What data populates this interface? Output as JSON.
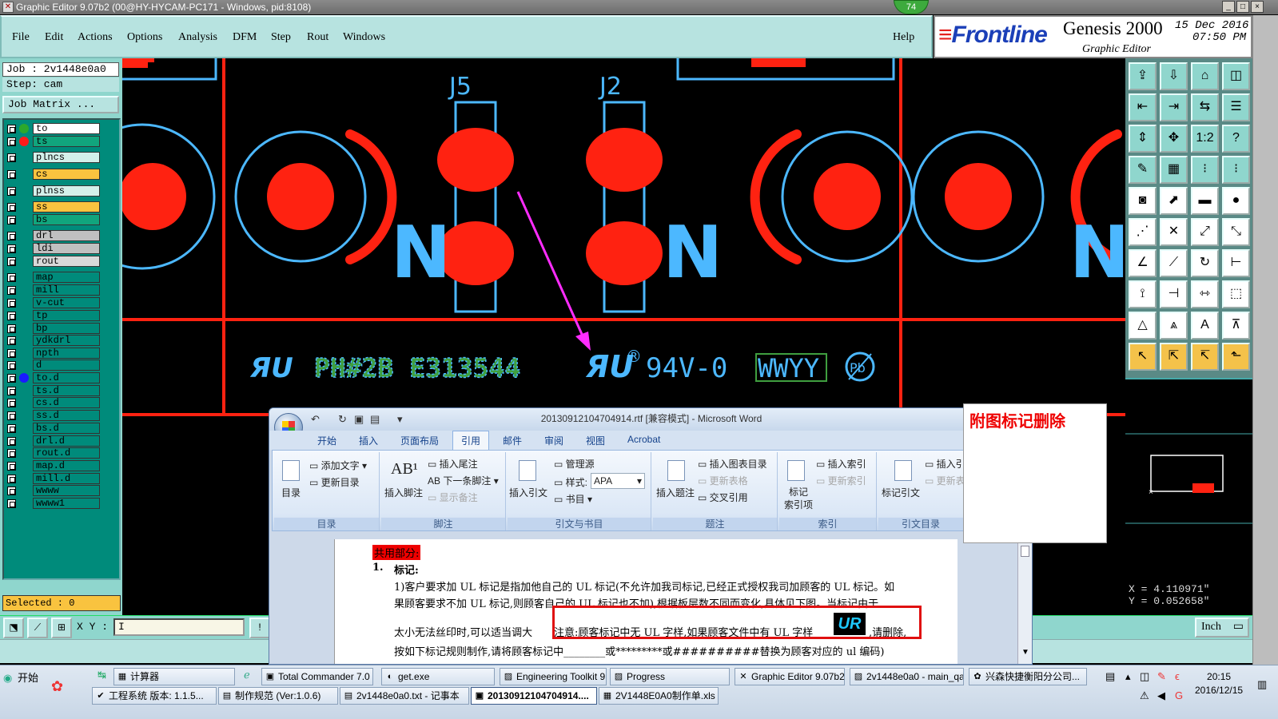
{
  "window": {
    "title": "Graphic Editor 9.07b2 (00@HY-HYCAM-PC171 - Windows, pid:8108)",
    "badge": "74",
    "buttons": [
      "_",
      "□",
      "×"
    ]
  },
  "menubar": {
    "items": [
      "File",
      "Edit",
      "Actions",
      "Options",
      "Analysis",
      "DFM",
      "Step",
      "Rout",
      "Windows"
    ],
    "help": "Help"
  },
  "brand": {
    "logo_prefix": "Front",
    "logo_suffix": "line",
    "product": "Genesis 2000",
    "subtitle": "Graphic Editor",
    "date": "15 Dec 2016",
    "time": "07:50 PM"
  },
  "job": {
    "job_label": "Job : 2v1448e0a0",
    "step_label": "Step: cam",
    "matrix_button": "Job Matrix ..."
  },
  "layers": [
    {
      "name": "to",
      "color": "#ffffff",
      "dot": "#2ca82c"
    },
    {
      "name": "ts",
      "color": "#11a57d",
      "dot": "#ff1a1a"
    },
    {
      "name": "plncs",
      "color": "#d3f0ea",
      "dot": ""
    },
    {
      "name": "cs",
      "color": "#f9c33f",
      "dot": ""
    },
    {
      "name": "plnss",
      "color": "#d3f0ea",
      "dot": ""
    },
    {
      "name": "ss",
      "color": "#f9c33f",
      "dot": ""
    },
    {
      "name": "bs",
      "color": "#11a57d",
      "dot": ""
    },
    {
      "name": "drl",
      "color": "#c0c0c0",
      "dot": ""
    },
    {
      "name": "ldi",
      "color": "#c0c0c0",
      "dot": ""
    },
    {
      "name": "rout",
      "color": "#d9d9d9",
      "dot": ""
    },
    {
      "name": "map",
      "color": "#008b7b",
      "dot": ""
    },
    {
      "name": "mill",
      "color": "#008b7b",
      "dot": ""
    },
    {
      "name": "v-cut",
      "color": "#008b7b",
      "dot": ""
    },
    {
      "name": "tp",
      "color": "#008b7b",
      "dot": ""
    },
    {
      "name": "bp",
      "color": "#008b7b",
      "dot": ""
    },
    {
      "name": "ydkdrl",
      "color": "#008b7b",
      "dot": ""
    },
    {
      "name": "npth",
      "color": "#008b7b",
      "dot": ""
    },
    {
      "name": "d",
      "color": "#008b7b",
      "dot": ""
    },
    {
      "name": "to.d",
      "color": "#008b7b",
      "dot": "#1a1aff"
    },
    {
      "name": "ts.d",
      "color": "#008b7b",
      "dot": ""
    },
    {
      "name": "cs.d",
      "color": "#008b7b",
      "dot": ""
    },
    {
      "name": "ss.d",
      "color": "#008b7b",
      "dot": ""
    },
    {
      "name": "bs.d",
      "color": "#008b7b",
      "dot": ""
    },
    {
      "name": "drl.d",
      "color": "#008b7b",
      "dot": ""
    },
    {
      "name": "rout.d",
      "color": "#008b7b",
      "dot": ""
    },
    {
      "name": "map.d",
      "color": "#008b7b",
      "dot": ""
    },
    {
      "name": "mill.d",
      "color": "#008b7b",
      "dot": ""
    },
    {
      "name": "wwww",
      "color": "#008b7b",
      "dot": ""
    },
    {
      "name": "wwww1",
      "color": "#008b7b",
      "dot": ""
    }
  ],
  "selected": "Selected : 0",
  "canvas": {
    "ref_j5": "J5",
    "ref_j2": "J2",
    "letter_n": "N",
    "marking_code": "PH#2B E313544",
    "flame_rating": "94V-0",
    "date_code": "WWYY",
    "pb_symbol": "Pb",
    "ul_symbol": "ЯU",
    "registered": "®"
  },
  "coords": {
    "x": "X = 4.110971\"",
    "y": "Y = 0.052658\""
  },
  "bottombar": {
    "xy_label": "X Y :",
    "xy_value": "I",
    "bang": "!",
    "unit": "Inch"
  },
  "word": {
    "title": "20130912104704914.rtf [兼容模式] - Microsoft Word",
    "tabs": [
      "开始",
      "插入",
      "页面布局",
      "引用",
      "邮件",
      "审阅",
      "视图",
      "Acrobat"
    ],
    "active_tab": "引用",
    "groups": {
      "toc": {
        "label": "目录",
        "big": "目录",
        "add_text": "添加文字",
        "update": "更新目录"
      },
      "footnote": {
        "label": "脚注",
        "big": "插入脚注",
        "insert_endnote": "插入尾注",
        "next_footnote": "下一条脚注",
        "show_notes": "显示备注"
      },
      "citation": {
        "label": "引文与书目",
        "big": "插入引文",
        "manage": "管理源",
        "style_label": "样式:",
        "style_value": "APA",
        "bibliography": "书目"
      },
      "caption": {
        "label": "题注",
        "big": "插入题注",
        "insert_tof": "插入图表目录",
        "update_table": "更新表格",
        "cross_ref": "交叉引用"
      },
      "index": {
        "label": "索引",
        "big": "标记\n索引项",
        "insert_index": "插入索引",
        "update_index": "更新索引"
      },
      "toa": {
        "label": "引文目录",
        "big": "标记引文",
        "insert_toa": "插入引",
        "update_toa": "更新表"
      }
    },
    "doc": {
      "shared": "共用部分:",
      "num": "1.",
      "heading": "标记:",
      "p1": "1)客户要求加 UL 标记是指加他自己的 UL 标记(不允许加我司标记,已经正式授权我司加顾客的 UL 标记。如",
      "p2": "果顾客要求不加 UL 标记,则顾客自己的 UL 标记也不加),根据板层数不同而变化,具体见下图。当标记由于",
      "p3_before": "太小无法丝印时,可以适当调大",
      "p3_note": "注意:顾客标记中无 UL 字样,如果顾客文件中有 UL 字样",
      "p3_after": ",请删除,",
      "p4": "按如下标记规则制作,请将顾客标记中________或*********或##########替换为顾客对应的 ul 编码)",
      "ul_icon": "UR"
    }
  },
  "note": "附图标记删除",
  "taskbar": {
    "start": "开始",
    "row1": [
      "计算器",
      "Total Commander 7.0 ...",
      "get.exe",
      "Engineering Toolkit 9.0...",
      "Progress",
      "Graphic Editor 9.07b2 ...",
      "2v1448e0a0 - main_qa",
      "兴森快捷衡阳分公司..."
    ],
    "row2": [
      "工程系统  版本: 1.1.5...",
      "制作规范 (Ver:1.0.6)",
      "2v1448e0a0.txt - 记事本",
      "20130912104704914....",
      "2V1448E0A0制作单.xls ..."
    ],
    "time": "20:15",
    "date": "2016/12/15"
  }
}
